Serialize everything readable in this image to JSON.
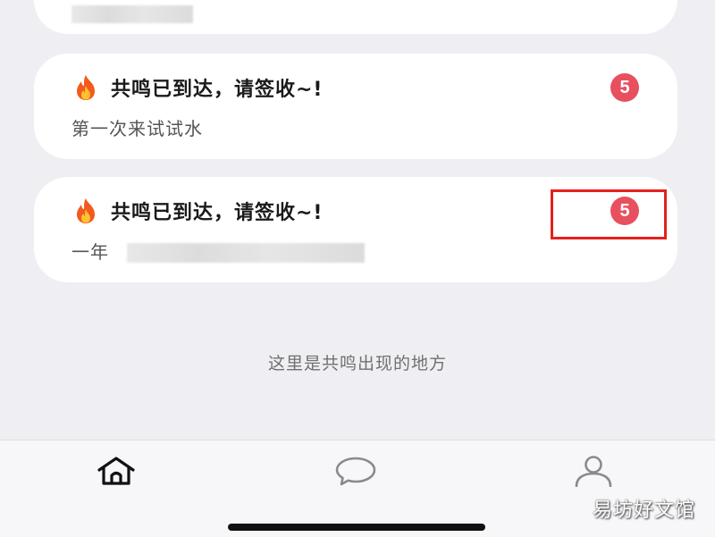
{
  "notifications": [
    {
      "title": "共鸣已到达，请签收~!",
      "body": "第一次来试试水",
      "badge": "5",
      "icon": "fire-icon"
    },
    {
      "title": "共鸣已到达，请签收~!",
      "body": "一年",
      "badge": "5",
      "icon": "fire-icon"
    }
  ],
  "empty_hint": "这里是共鸣出现的地方",
  "tabbar": {
    "tabs": [
      {
        "name": "home",
        "icon": "home-icon",
        "active": true
      },
      {
        "name": "messages",
        "icon": "chat-bubble-icon",
        "active": false
      },
      {
        "name": "profile",
        "icon": "user-icon",
        "active": false
      }
    ]
  },
  "watermark": "易坊好文馆",
  "colors": {
    "background": "#efeff3",
    "card": "#ffffff",
    "badge": "#e8505f",
    "highlight": "#e5201c",
    "tabbar": "#f7f7f9"
  }
}
